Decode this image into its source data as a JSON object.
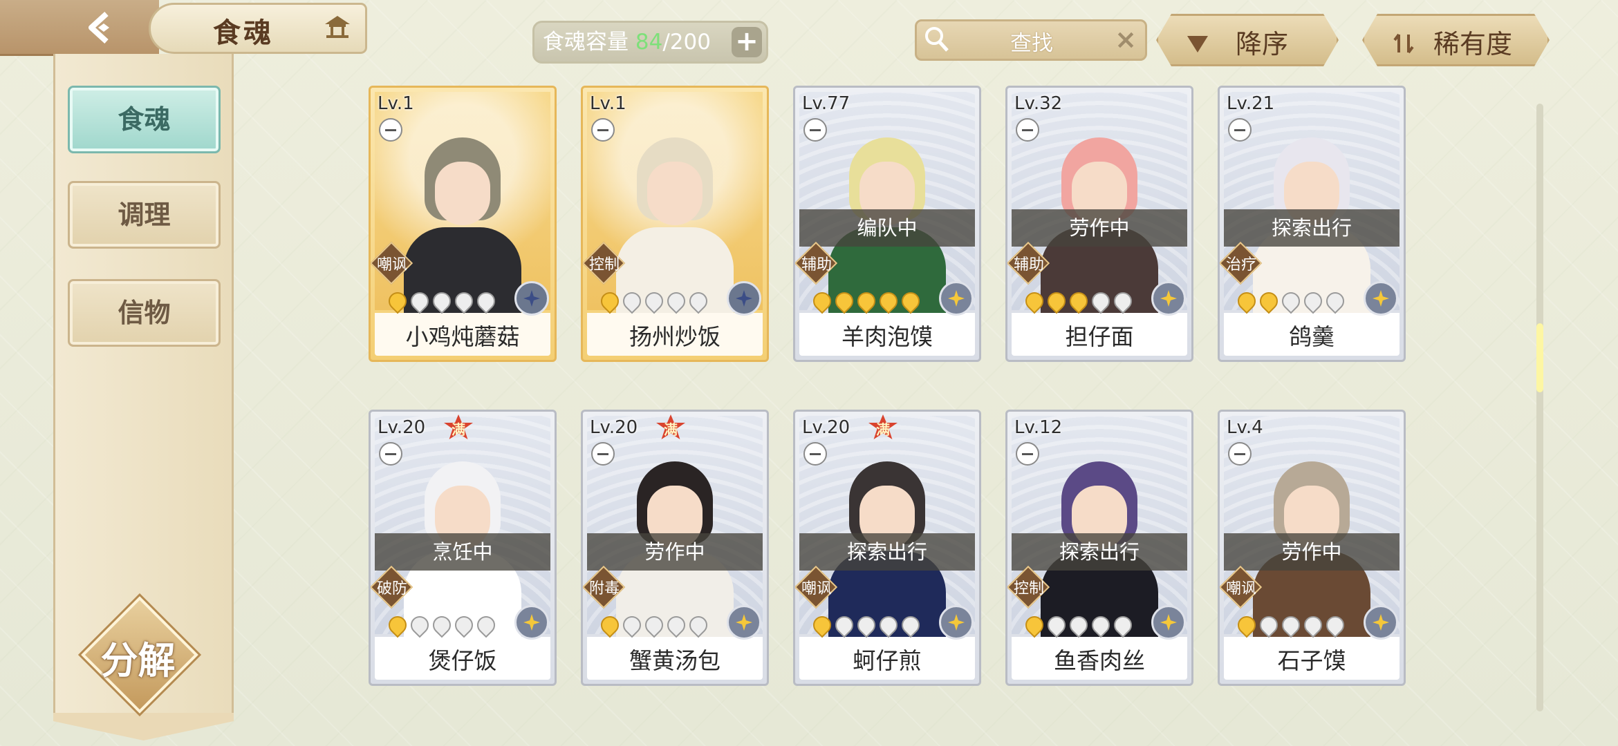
{
  "header": {
    "back_icon": "back-arrow-icon",
    "title": "食魂",
    "title_icon": "pavilion-icon",
    "capacity_label": "食魂容量",
    "capacity_current": "84",
    "capacity_max": "/200",
    "add_icon": "plus-icon",
    "search_placeholder": "查找",
    "search_icon": "search-icon",
    "clear_icon": "close-icon",
    "sort_order_label": "降序",
    "sort_field_label": "稀有度"
  },
  "sidebar": {
    "items": [
      {
        "label": "食魂",
        "active": true
      },
      {
        "label": "调理",
        "active": false
      },
      {
        "label": "信物",
        "active": false
      }
    ],
    "decompose_label": "分解"
  },
  "cards": [
    {
      "level": "Lv.1",
      "name": "小鸡炖蘑菇",
      "role": "嘲讽",
      "status": "",
      "max": false,
      "frame": "gold",
      "stars": 1,
      "element": "blue",
      "max_label": ""
    },
    {
      "level": "Lv.1",
      "name": "扬州炒饭",
      "role": "控制",
      "status": "",
      "max": false,
      "frame": "gold",
      "stars": 1,
      "element": "blue",
      "max_label": ""
    },
    {
      "level": "Lv.77",
      "name": "羊肉泡馍",
      "role": "辅助",
      "status": "编队中",
      "max": false,
      "frame": "silver",
      "stars": 5,
      "element": "yellow",
      "max_label": ""
    },
    {
      "level": "Lv.32",
      "name": "担仔面",
      "role": "辅助",
      "status": "劳作中",
      "max": false,
      "frame": "silver",
      "stars": 3,
      "element": "yellow",
      "max_label": ""
    },
    {
      "level": "Lv.21",
      "name": "鸽羹",
      "role": "治疗",
      "status": "探索出行",
      "max": false,
      "frame": "silver",
      "stars": 2,
      "element": "yellow",
      "max_label": ""
    },
    {
      "level": "Lv.20",
      "name": "煲仔饭",
      "role": "破防",
      "status": "烹饪中",
      "max": true,
      "frame": "silver",
      "stars": 1,
      "element": "yellow",
      "max_label": "满"
    },
    {
      "level": "Lv.20",
      "name": "蟹黄汤包",
      "role": "附毒",
      "status": "劳作中",
      "max": true,
      "frame": "silver",
      "stars": 1,
      "element": "yellow",
      "max_label": "满"
    },
    {
      "level": "Lv.20",
      "name": "蚵仔煎",
      "role": "嘲讽",
      "status": "探索出行",
      "max": true,
      "frame": "silver",
      "stars": 1,
      "element": "yellow",
      "max_label": "满"
    },
    {
      "level": "Lv.12",
      "name": "鱼香肉丝",
      "role": "控制",
      "status": "探索出行",
      "max": false,
      "frame": "silver",
      "stars": 1,
      "element": "yellow",
      "max_label": ""
    },
    {
      "level": "Lv.4",
      "name": "石子馍",
      "role": "嘲讽",
      "status": "劳作中",
      "max": false,
      "frame": "silver",
      "stars": 1,
      "element": "yellow",
      "max_label": ""
    }
  ],
  "colors": {
    "capacity_current": "#7ee07a",
    "active_tab": "#9fd7cc",
    "gold_frame": "#e6b759",
    "silver_frame": "#b9bcc4"
  }
}
